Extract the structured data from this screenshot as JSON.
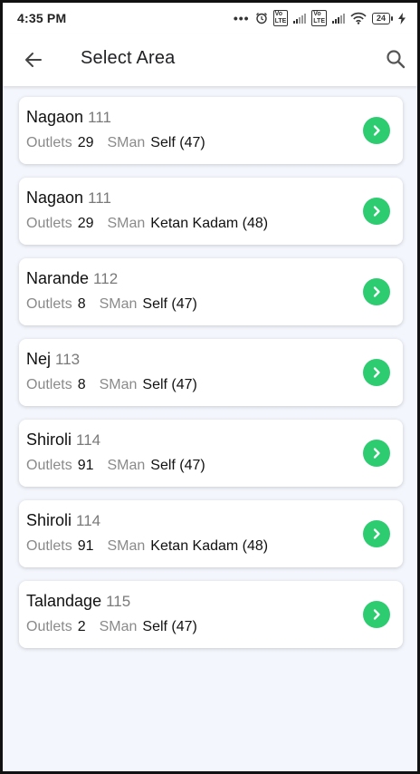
{
  "status_bar": {
    "time": "4:35 PM",
    "battery": "24"
  },
  "header": {
    "title": "Select Area"
  },
  "labels": {
    "outlets": "Outlets",
    "sman": "SMan"
  },
  "colors": {
    "accent": "#2ecc71",
    "background": "#f3f6fc"
  },
  "areas": [
    {
      "name": "Nagaon",
      "code": "111",
      "outlets": "29",
      "sman": "Self (47)"
    },
    {
      "name": "Nagaon",
      "code": "111",
      "outlets": "29",
      "sman": "Ketan Kadam (48)"
    },
    {
      "name": "Narande",
      "code": "112",
      "outlets": "8",
      "sman": "Self (47)"
    },
    {
      "name": "Nej",
      "code": "113",
      "outlets": "8",
      "sman": "Self (47)"
    },
    {
      "name": "Shiroli",
      "code": "114",
      "outlets": "91",
      "sman": "Self (47)"
    },
    {
      "name": "Shiroli",
      "code": "114",
      "outlets": "91",
      "sman": "Ketan Kadam (48)"
    },
    {
      "name": "Talandage",
      "code": "115",
      "outlets": "2",
      "sman": "Self (47)"
    }
  ]
}
